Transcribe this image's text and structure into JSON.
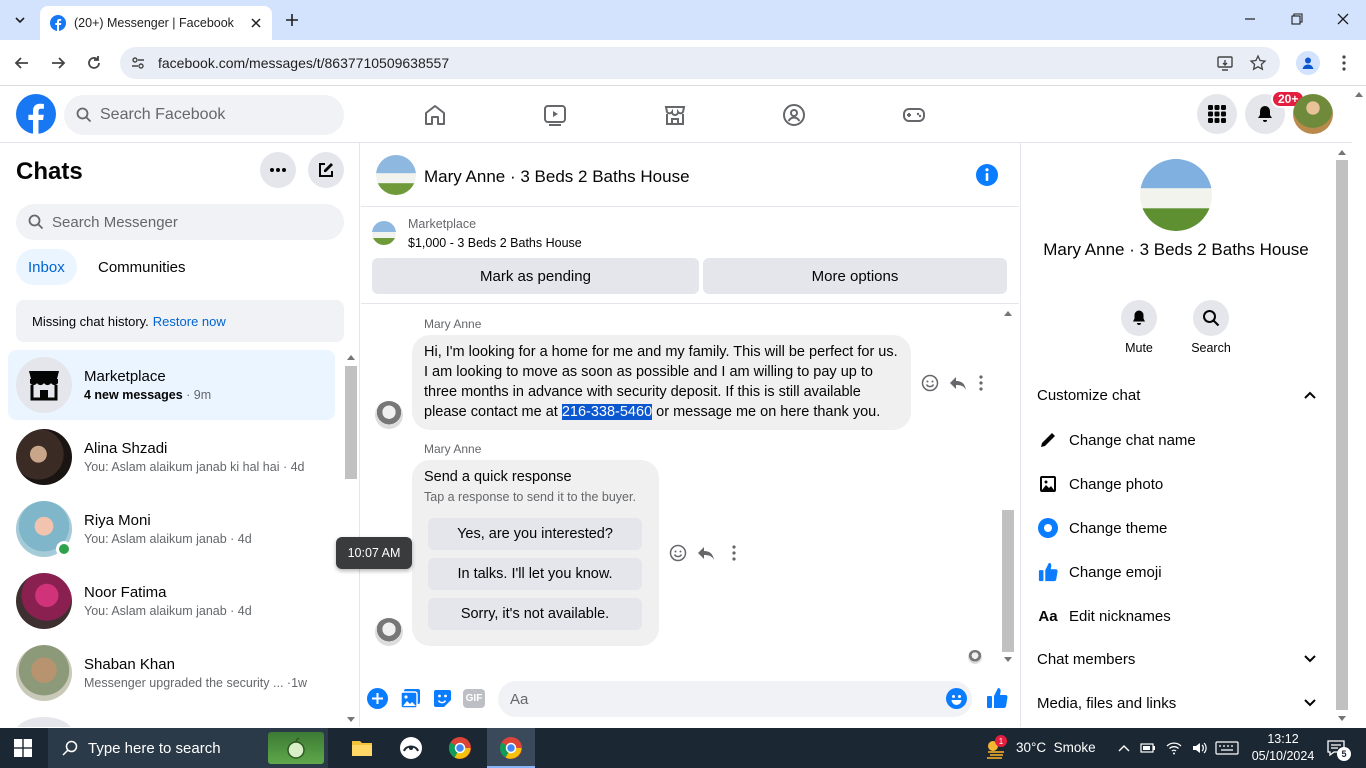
{
  "browser": {
    "tab_title": "(20+) Messenger | Facebook",
    "url": "facebook.com/messages/t/8637710509638557"
  },
  "fb": {
    "search_placeholder": "Search Facebook",
    "notif_badge": "20+"
  },
  "chats": {
    "title": "Chats",
    "search_placeholder": "Search Messenger",
    "tabs": [
      "Inbox",
      "Communities"
    ],
    "missing_history": "Missing chat history.",
    "restore_link": "Restore now",
    "items": [
      {
        "name": "Marketplace",
        "sub": "4 new messages",
        "time": "9m"
      },
      {
        "name": "Alina Shzadi",
        "sub": "You: Aslam alaikum janab ki hal hai",
        "time": "4d"
      },
      {
        "name": "Riya Moni",
        "sub": "You: Aslam alaikum janab",
        "time": "4d"
      },
      {
        "name": "Noor Fatima",
        "sub": "You: Aslam alaikum janab",
        "time": "4d"
      },
      {
        "name": "Shaban Khan",
        "sub": "Messenger upgraded the security ...",
        "time": "1w"
      }
    ]
  },
  "conversation": {
    "title": "Mary Anne · 3 Beds 2 Baths House",
    "listing_source": "Marketplace",
    "listing_title": "$1,000 - 3 Beds 2 Baths House",
    "mark_pending": "Mark as pending",
    "more_options": "More options",
    "sender": "Mary Anne",
    "message_before": "Hi, I'm looking for a home for me and my family. This will be perfect for us. I am looking to move as soon as possible and I am willing to pay up to three months in advance with security deposit. If this is still available please contact me at ",
    "message_phone": "216-338-5460",
    "message_after": " or message me on here thank you.",
    "sender2": "Mary Anne",
    "quick_title": "Send a quick response",
    "quick_sub": "Tap a response to send it to the buyer.",
    "quick_options": [
      "Yes, are you interested?",
      "In talks. I'll let you know.",
      "Sorry, it's not available."
    ],
    "tooltip_time": "10:07 AM",
    "composer_placeholder": "Aa"
  },
  "details": {
    "title": "Mary Anne · 3 Beds 2 Baths House",
    "mute": "Mute",
    "search": "Search",
    "customize": "Customize chat",
    "change_name": "Change chat name",
    "change_photo": "Change photo",
    "change_theme": "Change theme",
    "change_emoji": "Change emoji",
    "nicknames_prefix": "Aa",
    "edit_nicknames": "Edit nicknames",
    "chat_members": "Chat members",
    "media": "Media, files and links"
  },
  "taskbar": {
    "search_placeholder": "Type here to search",
    "weather": "30°C  Smoke",
    "time": "13:12",
    "date": "05/10/2024",
    "weather_badge": "1",
    "notif_count": "5"
  },
  "colors": {
    "brand": "#1877f2",
    "accent_red": "#e41e3f",
    "taskbar": "#1b2733",
    "tab_bar": "#d3e3fd"
  }
}
